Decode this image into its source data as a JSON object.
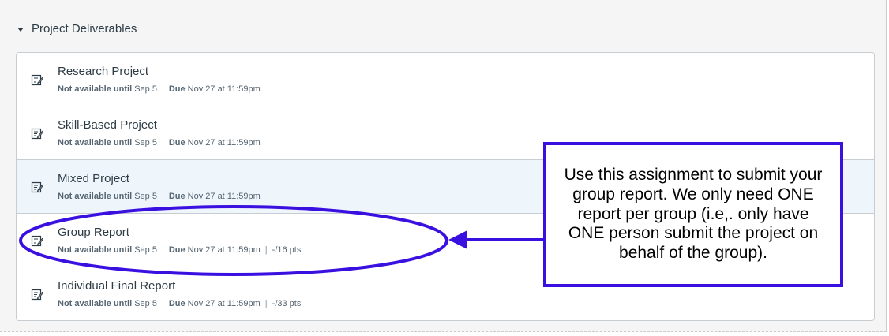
{
  "section": {
    "title": "Project Deliverables"
  },
  "icons": {
    "caret": "caret-down-icon",
    "assignment": "assignment-edit-icon"
  },
  "assignments": [
    {
      "title": "Research Project",
      "availability_label": "Not available until",
      "availability_date": "Sep 5",
      "due_label": "Due",
      "due_date": "Nov 27 at 11:59pm",
      "points": ""
    },
    {
      "title": "Skill-Based Project",
      "availability_label": "Not available until",
      "availability_date": "Sep 5",
      "due_label": "Due",
      "due_date": "Nov 27 at 11:59pm",
      "points": ""
    },
    {
      "title": "Mixed Project",
      "availability_label": "Not available until",
      "availability_date": "Sep 5",
      "due_label": "Due",
      "due_date": "Nov 27 at 11:59pm",
      "points": ""
    },
    {
      "title": "Group Report",
      "availability_label": "Not available until",
      "availability_date": "Sep 5",
      "due_label": "Due",
      "due_date": "Nov 27 at 11:59pm",
      "points": "-/16 pts"
    },
    {
      "title": "Individual Final Report",
      "availability_label": "Not available until",
      "availability_date": "Sep 5",
      "due_label": "Due",
      "due_date": "Nov 27 at 11:59pm",
      "points": "-/33 pts"
    }
  ],
  "callout": {
    "text": "Use this assignment to submit your group report. We only need ONE report per group (i.e,. only have ONE person submit the project on behalf of the group)."
  },
  "colors": {
    "annotation": "#3a10e0",
    "row_highlight": "#eef5fb",
    "text_primary": "#2d3b45",
    "text_secondary": "#556572"
  }
}
